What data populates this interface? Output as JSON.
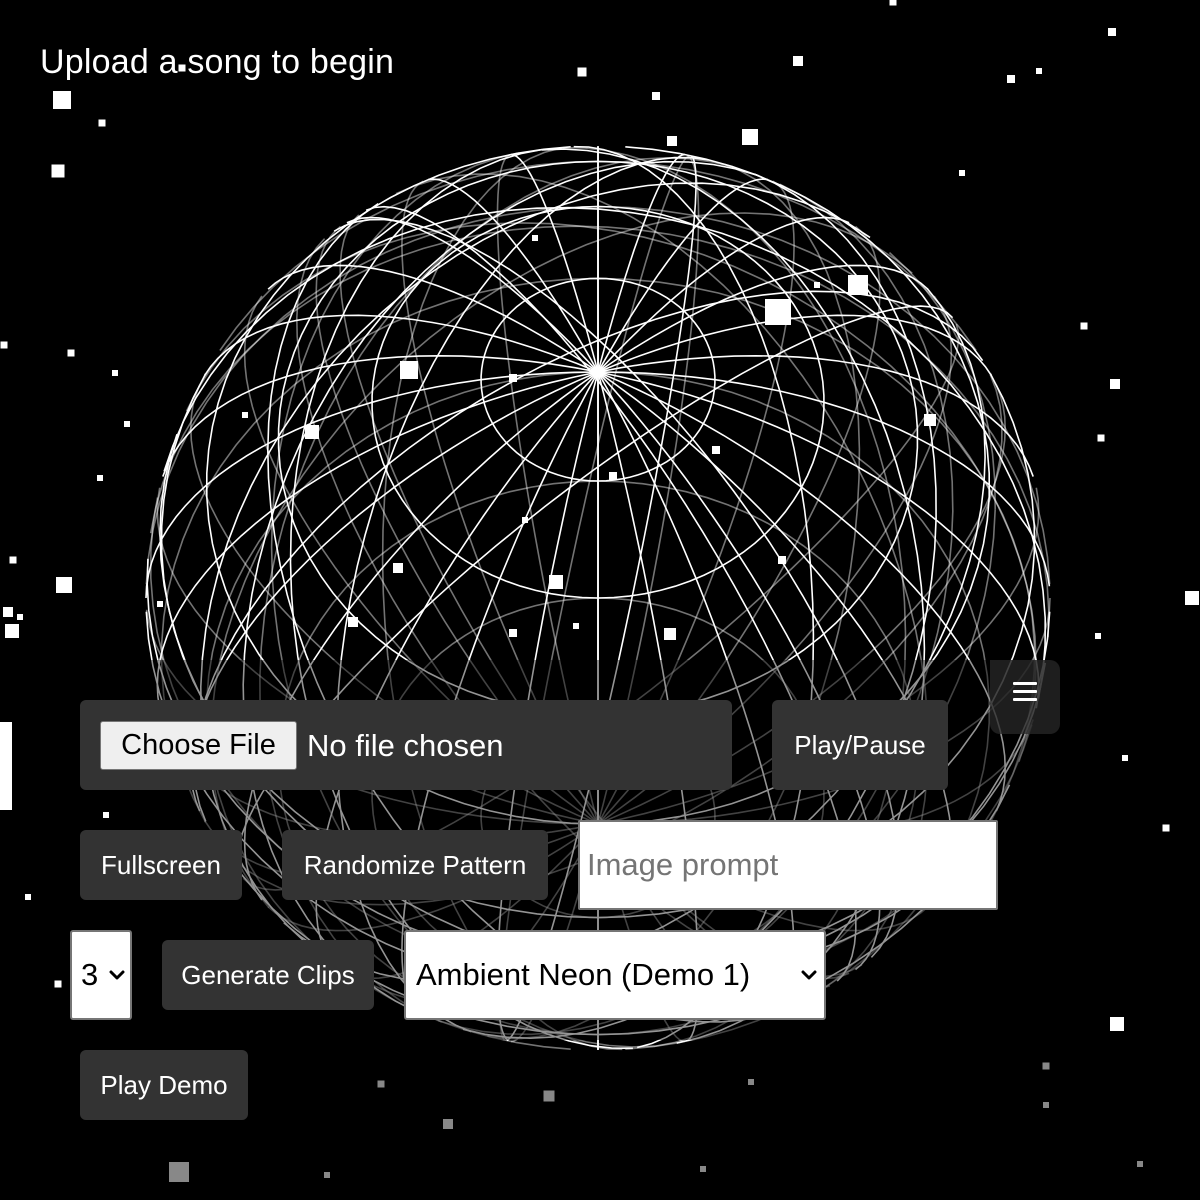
{
  "status_text": "Upload a song to begin",
  "menu": {
    "icon": "hamburger-menu-icon"
  },
  "file_input": {
    "button_label": "Choose File",
    "status": "No file chosen"
  },
  "buttons": {
    "play_pause": "Play/Pause",
    "fullscreen": "Fullscreen",
    "randomize": "Randomize Pattern",
    "generate": "Generate Clips",
    "play_demo": "Play Demo"
  },
  "image_prompt": {
    "value": "",
    "placeholder": "Image prompt"
  },
  "clip_count": {
    "selected": "3"
  },
  "demo_select": {
    "selected": "Ambient Neon (Demo 1)"
  },
  "colors": {
    "background": "#000000",
    "wireframe": "#ffffff",
    "button_bg": "#333333",
    "button_text": "#ffffff"
  }
}
